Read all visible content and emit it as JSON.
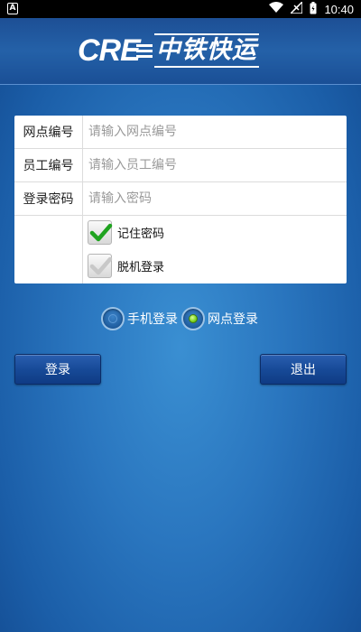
{
  "status_bar": {
    "time": "10:40",
    "left_icon": "notification-a-icon",
    "right_icons": [
      "wifi-icon",
      "signal-icon",
      "battery-icon"
    ]
  },
  "header": {
    "logo_latin": "CRE",
    "logo_chinese": "中铁快运"
  },
  "form": {
    "rows": [
      {
        "label": "网点编号",
        "placeholder": "请输入网点编号",
        "value": ""
      },
      {
        "label": "员工编号",
        "placeholder": "请输入员工编号",
        "value": ""
      },
      {
        "label": "登录密码",
        "placeholder": "请输入密码",
        "value": ""
      }
    ],
    "checkboxes": [
      {
        "label": "记住密码",
        "checked": true
      },
      {
        "label": "脱机登录",
        "checked": false
      }
    ]
  },
  "login_mode": {
    "options": [
      {
        "label": "手机登录",
        "selected": false
      },
      {
        "label": "网点登录",
        "selected": true
      }
    ]
  },
  "buttons": {
    "login": "登录",
    "exit": "退出"
  },
  "colors": {
    "background": "#2a76bf",
    "header": "#2461a8",
    "button": "#174a98",
    "check_green": "#1fa31f",
    "radio_selected": "#7bd21e"
  }
}
